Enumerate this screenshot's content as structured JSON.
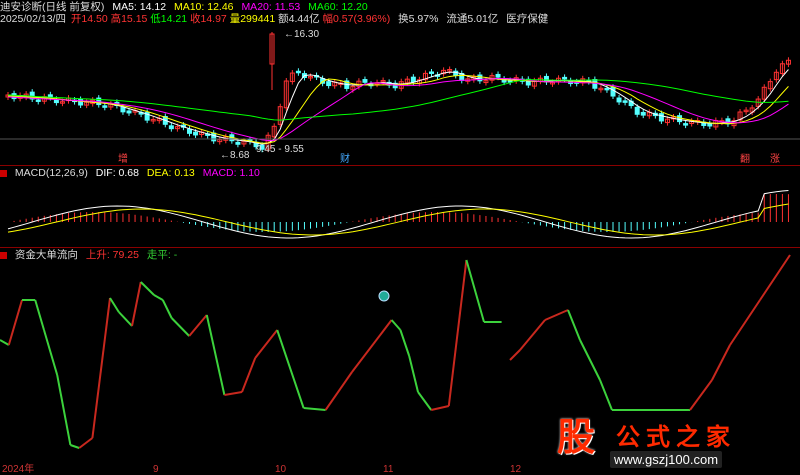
{
  "kline": {
    "title": "迪安诊断(日线 前复权)",
    "ma5": "MA5: 14.12",
    "ma10": "MA10: 12.46",
    "ma20": "MA20: 11.53",
    "ma60": "MA60: 12.20",
    "date": "2025/02/13/四",
    "open": "开14.50",
    "high": "高15.15",
    "low": "低14.21",
    "close": "收14.97",
    "volume": "量299441",
    "amount": "额4.44亿",
    "change": "幅0.57(3.96%)",
    "turnover": "换5.97%",
    "float": "流通5.01亿",
    "sector": "医疗保健",
    "price_high": "16.30",
    "price_low": "8.68",
    "range_note": "9.45 - 9.55",
    "marks": [
      "增",
      "财",
      "翻",
      "涨"
    ]
  },
  "macd": {
    "title": "MACD(12,26,9)",
    "dif": "DIF: 0.68",
    "dea": "DEA: 0.13",
    "macd": "MACD: 1.10"
  },
  "flow": {
    "title": "资金大单流向",
    "up": "上升: 79.25",
    "flat": "走平: -"
  },
  "axis": {
    "ticks": [
      "2024年",
      "9",
      "10",
      "11",
      "12"
    ]
  },
  "colors": {
    "up": "#ff3232",
    "down": "#54ffff",
    "ma5": "#ffffff",
    "ma10": "#ffff00",
    "ma20": "#ff00ff",
    "ma60": "#00ff00",
    "flow_up": "#c8281e",
    "flow_down": "#3cd23c"
  },
  "watermark": {
    "logo": "股",
    "title": "公式之家",
    "url": "www.gszj100.com"
  }
}
